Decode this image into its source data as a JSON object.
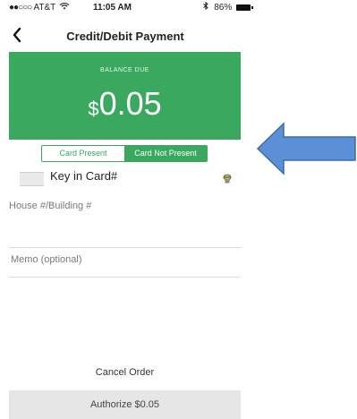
{
  "status_bar": {
    "signal": "●●○○○",
    "carrier": "AT&T",
    "wifi_icon": "wifi-icon",
    "time": "11:05 AM",
    "bluetooth_icon": "bluetooth-icon",
    "battery": "86%",
    "battery_level": 0.86
  },
  "nav": {
    "back_icon": "chevron-left-icon",
    "title": "Credit/Debit Payment"
  },
  "balance": {
    "label": "BALANCE DUE",
    "currency": "$",
    "amount": "0.05",
    "background_color": "#3aa85e"
  },
  "segments": {
    "card_present": "Card Present",
    "card_not_present": "Card Not Present",
    "selected": "Card Not Present",
    "accent_color": "#3aa85e"
  },
  "card_entry": {
    "label": "Key in Card#",
    "card_icon": "credit-card-icon",
    "scan_icon": "card-scan-icon"
  },
  "fields": {
    "house_placeholder": "House #/Building #",
    "memo_placeholder": "Memo (optional)"
  },
  "actions": {
    "cancel": "Cancel Order",
    "authorize": "Authorize $0.05"
  },
  "annotation": {
    "arrow_icon": "left-arrow-icon",
    "arrow_color": "#5b8fd6"
  }
}
